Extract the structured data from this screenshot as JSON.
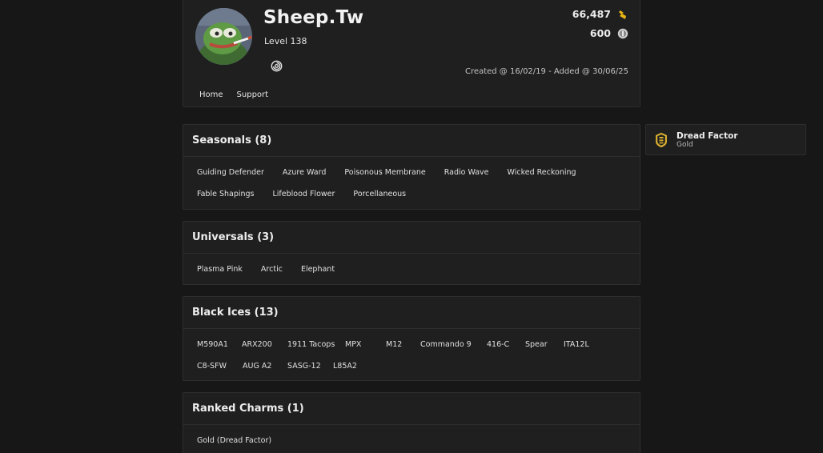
{
  "profile": {
    "username": "Sheep.Tw",
    "level": "Level 138",
    "credits": "66,487",
    "renown": "600",
    "dates": "Created @ 16/02/19 - Added @ 30/06/25",
    "nav": [
      "Home",
      "Support"
    ]
  },
  "icons": {
    "credits": "r6-credits-icon",
    "renown": "renown-coin-icon",
    "platform": "ubisoft-icon",
    "rank": "gold-rank-icon"
  },
  "colors": {
    "background": "#171717",
    "panel": "#1f1f1f",
    "credits_gold": "#e8b414",
    "rank_gold": "#d6ac2f"
  },
  "sections": {
    "seasonals": {
      "title": "Seasonals (8)",
      "items": [
        "Guiding Defender",
        "Azure Ward",
        "Poisonous Membrane",
        "Radio Wave",
        "Wicked Reckoning",
        "Fable Shapings",
        "Lifeblood Flower",
        "Porcellaneous"
      ]
    },
    "universals": {
      "title": "Universals (3)",
      "items": [
        "Plasma Pink",
        "Arctic",
        "Elephant"
      ]
    },
    "black_ices": {
      "title": "Black Ices (13)",
      "items": [
        "M590A1",
        "ARX200",
        "1911 Tacops",
        "MPX",
        "M12",
        "Commando 9",
        "416-C",
        "Spear",
        "ITA12L",
        "C8-SFW",
        "AUG A2",
        "SASG-12",
        "L85A2"
      ]
    },
    "ranked_charms": {
      "title": "Ranked Charms (1)",
      "items": [
        "Gold (Dread Factor)"
      ]
    }
  },
  "rank_card": {
    "name": "Dread Factor",
    "tier": "Gold"
  }
}
